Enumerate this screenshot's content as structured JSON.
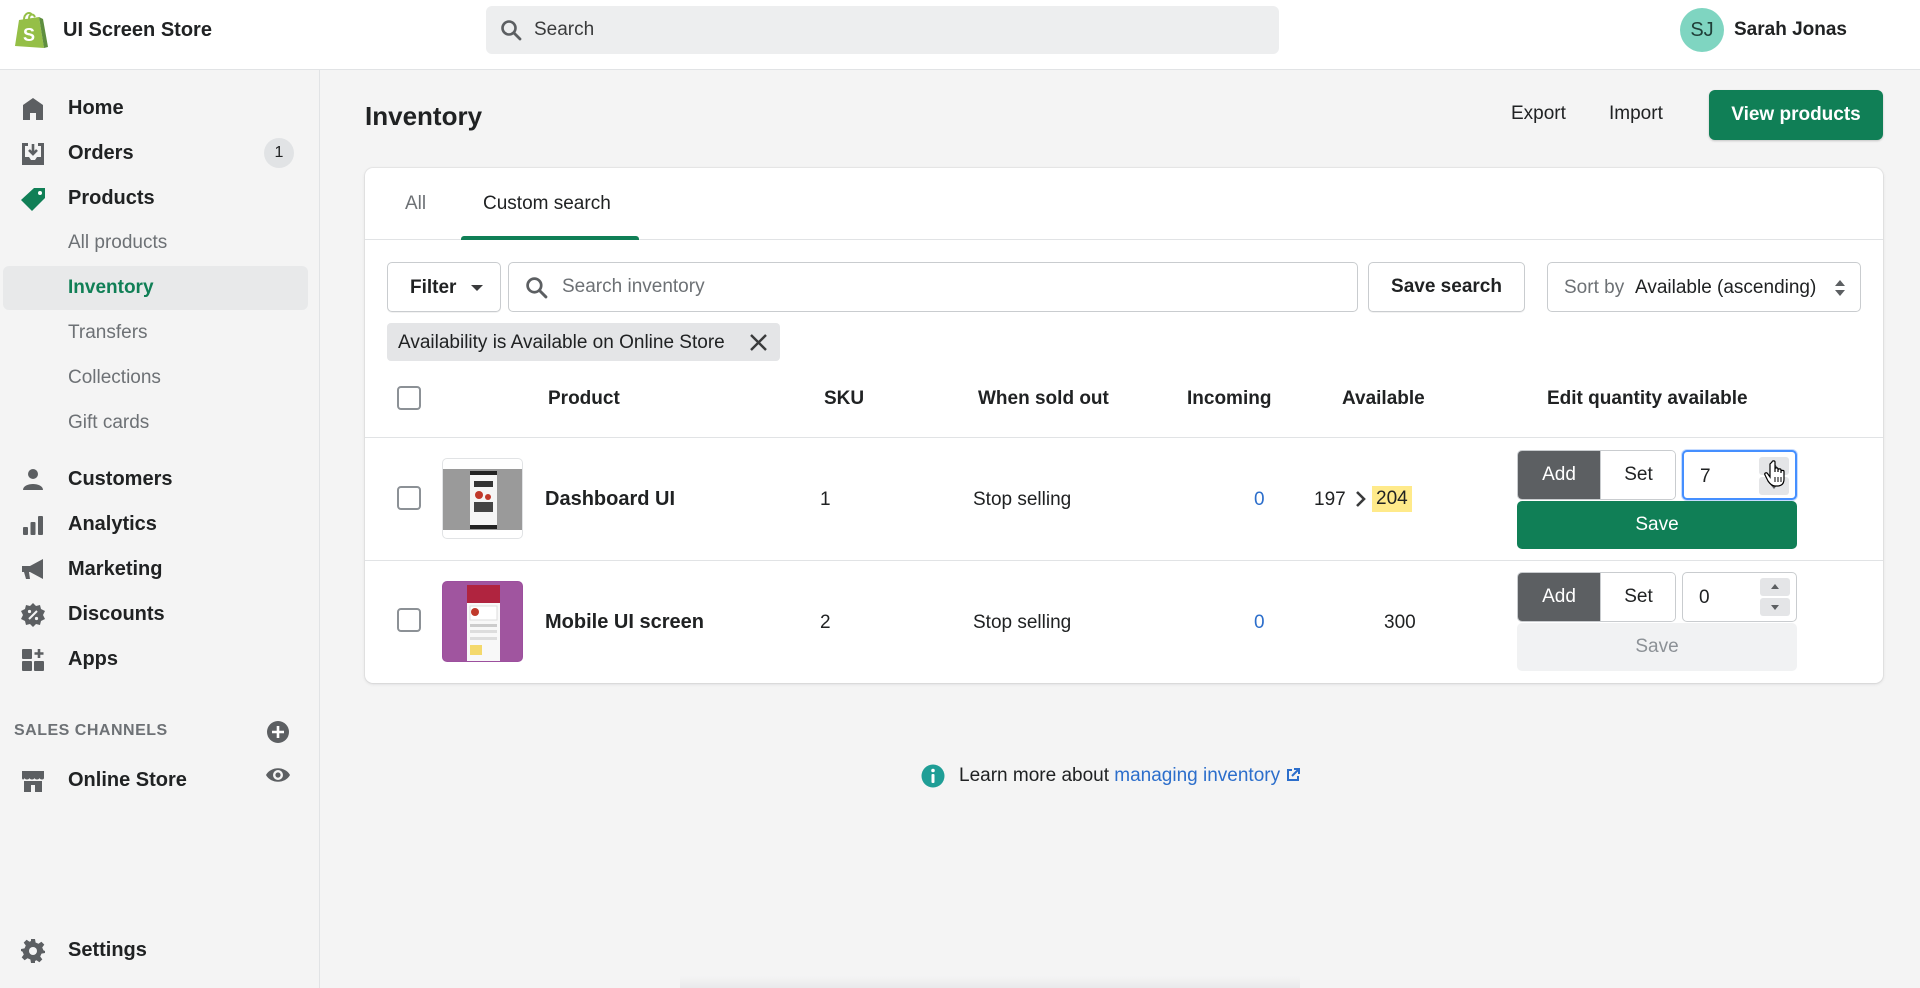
{
  "app": {
    "store_name": "UI Screen Store",
    "brand_color": "#107f56",
    "search_placeholder": "Search",
    "user": {
      "initials": "SJ",
      "name": "Sarah Jonas",
      "avatar_color": "#7fd5c1"
    }
  },
  "sidebar": {
    "items": [
      {
        "label": "Home",
        "icon": "home-icon"
      },
      {
        "label": "Orders",
        "icon": "orders-icon",
        "badge": "1"
      },
      {
        "label": "Products",
        "icon": "tag-icon",
        "active_section": true
      }
    ],
    "product_subitems": [
      {
        "label": "All products"
      },
      {
        "label": "Inventory",
        "active": true
      },
      {
        "label": "Transfers"
      },
      {
        "label": "Collections"
      },
      {
        "label": "Gift cards"
      }
    ],
    "more_items": [
      {
        "label": "Customers",
        "icon": "customer-icon"
      },
      {
        "label": "Analytics",
        "icon": "analytics-icon"
      },
      {
        "label": "Marketing",
        "icon": "megaphone-icon"
      },
      {
        "label": "Discounts",
        "icon": "discount-icon"
      },
      {
        "label": "Apps",
        "icon": "apps-icon"
      }
    ],
    "sales_channels_heading": "SALES CHANNELS",
    "channels": [
      {
        "label": "Online Store",
        "icon": "store-icon"
      }
    ],
    "settings_label": "Settings"
  },
  "page": {
    "title": "Inventory",
    "actions": {
      "export": "Export",
      "import": "Import",
      "primary": "View products"
    }
  },
  "tabs": [
    {
      "label": "All",
      "active": false
    },
    {
      "label": "Custom search",
      "active": true
    }
  ],
  "toolbar": {
    "filter_label": "Filter",
    "search_placeholder": "Search inventory",
    "save_search_label": "Save search",
    "sort_prefix": "Sort by",
    "sort_value": "Available (ascending)"
  },
  "applied_filters": [
    {
      "label": "Availability is Available on Online Store"
    }
  ],
  "table": {
    "columns": [
      "Product",
      "SKU",
      "When sold out",
      "Incoming",
      "Available",
      "Edit quantity available"
    ],
    "rows": [
      {
        "product": "Dashboard UI",
        "sku": "1",
        "when_sold_out": "Stop selling",
        "incoming": "0",
        "available": "197",
        "available_new": "204",
        "mode_add": "Add",
        "mode_set": "Set",
        "quantity": "7",
        "save_label": "Save",
        "save_enabled": true
      },
      {
        "product": "Mobile UI screen",
        "sku": "2",
        "when_sold_out": "Stop selling",
        "incoming": "0",
        "available": "300",
        "mode_add": "Add",
        "mode_set": "Set",
        "quantity": "0",
        "save_label": "Save",
        "save_enabled": false
      }
    ]
  },
  "help": {
    "prefix": "Learn more about ",
    "link_text": "managing inventory"
  }
}
